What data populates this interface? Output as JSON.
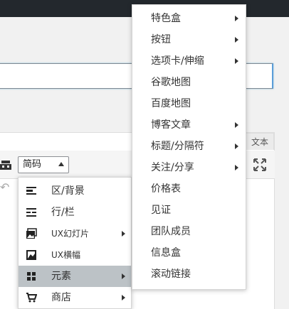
{
  "editor": {
    "tab_text_label": "文本",
    "format_select_value": "简码"
  },
  "left_menu": {
    "items": [
      {
        "label": "区/背景",
        "icon": "section-icon",
        "has_submenu": false
      },
      {
        "label": "行/栏",
        "icon": "columns-icon",
        "has_submenu": false
      },
      {
        "label": "UX幻灯片",
        "icon": "slider-icon",
        "has_submenu": true
      },
      {
        "label": "UX横幅",
        "icon": "banner-image-icon",
        "has_submenu": false
      },
      {
        "label": "元素",
        "icon": "grid-icon",
        "has_submenu": true,
        "active": true
      },
      {
        "label": "商店",
        "icon": "cart-icon",
        "has_submenu": true
      }
    ]
  },
  "right_menu": {
    "items": [
      {
        "label": "特色盒",
        "has_submenu": true
      },
      {
        "label": "按钮",
        "has_submenu": true
      },
      {
        "label": "选项卡/伸缩",
        "has_submenu": true
      },
      {
        "label": "谷歌地图",
        "has_submenu": false
      },
      {
        "label": "百度地图",
        "has_submenu": false
      },
      {
        "label": "博客文章",
        "has_submenu": true
      },
      {
        "label": "标题/分隔符",
        "has_submenu": true
      },
      {
        "label": "关注/分享",
        "has_submenu": true
      },
      {
        "label": "价格表",
        "has_submenu": false
      },
      {
        "label": "见证",
        "has_submenu": false
      },
      {
        "label": "团队成员",
        "has_submenu": false
      },
      {
        "label": "信息盒",
        "has_submenu": false
      },
      {
        "label": "滚动链接",
        "has_submenu": false
      }
    ]
  },
  "colors": {
    "admin_bar": "#23282d",
    "active_item": "#bcc2c6",
    "focus_border": "#5b9dd9"
  }
}
